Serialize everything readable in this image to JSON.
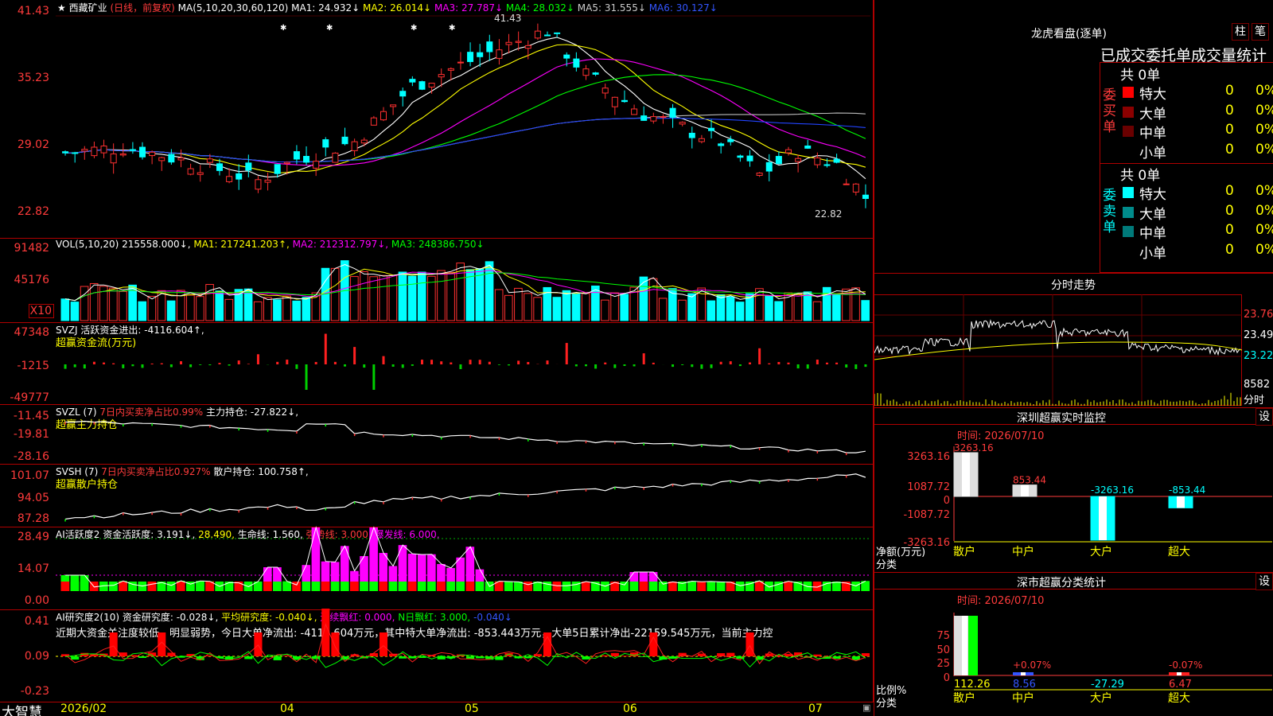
{
  "stock": {
    "star": "★",
    "name": "西藏矿业",
    "mode": "(日线，前复权)",
    "ma_title": "MA(5,10,20,30,60,120)"
  },
  "ma_values": [
    {
      "label": "MA1: 24.932↓",
      "color": "#ffffff"
    },
    {
      "label": "MA2: 26.014↓",
      "color": "#ffff00"
    },
    {
      "label": "MA3: 27.787↓",
      "color": "#ff00ff"
    },
    {
      "label": "MA4: 28.032↓",
      "color": "#00ff00"
    },
    {
      "label": "MA5: 31.555↓",
      "color": "#cccccc"
    },
    {
      "label": "MA6: 30.127↓",
      "color": "#3355ff"
    }
  ],
  "main_axis": [
    "41.43",
    "35.23",
    "29.02",
    "22.82"
  ],
  "price_hi": "41.43",
  "price_lo": "22.82",
  "vol": {
    "title": "VOL(5,10,20)",
    "value": "215558.000↓,",
    "ma1": "MA1: 217241.203↑,",
    "ma2": "MA2: 212312.797↓,",
    "ma3": "MA3: 248386.750↓",
    "axis": [
      "91482",
      "45176",
      "X10"
    ]
  },
  "svzj": {
    "title": "SVZJ",
    "desc": "活跃资金进出: -4116.604↑,",
    "sub": "超赢资金流(万元)",
    "axis": [
      "47348",
      "-1215",
      "-49777"
    ]
  },
  "svzl": {
    "title": "SVZL (7)",
    "desc": "7日内买卖净占比0.99%",
    "hold": "主力持仓: -27.822↓,",
    "sub": "超赢主力持仓",
    "axis": [
      "-11.45",
      "-19.81",
      "-28.16"
    ]
  },
  "svsh": {
    "title": "SVSH (7)",
    "desc": "7日内买卖净占比0.927%",
    "hold": "散户持仓: 100.758↑,",
    "sub": "超赢散户持仓",
    "axis": [
      "101.07",
      "94.05",
      "87.28"
    ]
  },
  "ai1": {
    "title": "AI活跃度2",
    "v1": "资金活跃度: 3.191↓,",
    "v2": "28.490,",
    "v3": "生命线: 1.560,",
    "v4": "强势线: 3.000,",
    "v5": "爆发线: 6.000,",
    "axis": [
      "28.49",
      "14.07",
      "0.00"
    ]
  },
  "ai2": {
    "title": "AI研究度2(10)",
    "v1": "资金研究度: -0.028↓,",
    "v2": "平均研究度: -0.040↓,",
    "v3": "连续飘红: 0.000,",
    "v4": "N日飘红: 3.000,",
    "v5": "-0.040↓",
    "axis": [
      "0.41",
      "0.09",
      "-0.23"
    ],
    "note": "近期大资金关注度较低，明显弱势，今日大单净流出: -4116.604万元，其中特大单净流出: -853.443万元，大单5日累计净出-22159.545万元，当前主力控"
  },
  "time_axis": {
    "brand": "大智慧",
    "labels": [
      "2026/02",
      "04",
      "05",
      "06",
      "07"
    ]
  },
  "lhb": {
    "title": "龙虎看盘(逐单)",
    "btn1": "柱",
    "btn2": "笔",
    "subtitle": "已成交委托单成交量统计",
    "buy_label": "委买单",
    "sell_label": "委卖单",
    "buy_total": "共 0单",
    "sell_total": "共 0单",
    "buy_rows": [
      {
        "name": "特大",
        "count": "0",
        "pct": "0%",
        "color": "#ff0000"
      },
      {
        "name": "大单",
        "count": "0",
        "pct": "0%",
        "color": "#8b0000"
      },
      {
        "name": "中单",
        "count": "0",
        "pct": "0%",
        "color": "#6a0000"
      },
      {
        "name": "小单",
        "count": "0",
        "pct": "0%",
        "color": "#000000"
      }
    ],
    "sell_rows": [
      {
        "name": "特大",
        "count": "0",
        "pct": "0%",
        "color": "#00ffff"
      },
      {
        "name": "大单",
        "count": "0",
        "pct": "0%",
        "color": "#008b8b"
      },
      {
        "name": "中单",
        "count": "0",
        "pct": "0%",
        "color": "#007a7a"
      },
      {
        "name": "小单",
        "count": "0",
        "pct": "0%",
        "color": "#000000"
      }
    ]
  },
  "fenshi": {
    "title": "分时走势",
    "axis": [
      "23.76",
      "23.49",
      "23.22"
    ],
    "vol_label": "8582",
    "unit": "分时"
  },
  "sz_monitor": {
    "title": "深圳超赢实时监控",
    "btn": "设",
    "time": "时间: 2026/07/10",
    "axis": [
      "3263.16",
      "1087.72",
      "0",
      "-1087.72",
      "-3263.16"
    ],
    "ylabel": "净额(万元)",
    "xlabel": "分类",
    "bars": [
      {
        "cat": "散户",
        "val": 3263.16,
        "lab": "3263.16"
      },
      {
        "cat": "中户",
        "val": 853.44,
        "lab": "853.44"
      },
      {
        "cat": "大户",
        "val": -3263.16,
        "lab": "-3263.16"
      },
      {
        "cat": "超大",
        "val": -853.44,
        "lab": "-853.44"
      }
    ]
  },
  "sz_class": {
    "title": "深市超赢分类统计",
    "btn": "设",
    "time": "时间: 2026/07/10",
    "axis": [
      "75",
      "50",
      "25",
      "0"
    ],
    "ylabel": "比例%",
    "xlabel": "分类",
    "bars": [
      {
        "cat": "散户",
        "val": 112.26,
        "lab": "112.26",
        "top": ""
      },
      {
        "cat": "中户",
        "val": 8.56,
        "lab": "8.56",
        "top": "+0.07%"
      },
      {
        "cat": "大户",
        "val": -27.29,
        "lab": "-27.29",
        "top": ""
      },
      {
        "cat": "超大",
        "val": 6.47,
        "lab": "6.47",
        "top": "-0.07%"
      }
    ]
  }
}
